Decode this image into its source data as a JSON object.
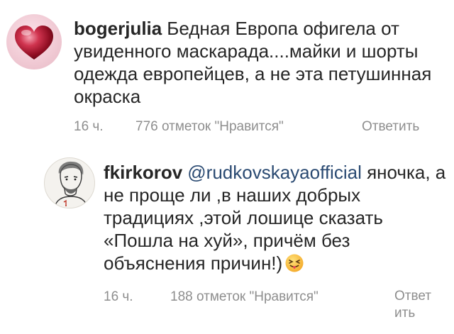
{
  "comments": [
    {
      "username": "bogerjulia",
      "text": "Бедная Европа офигела от увиденного маскарада....майки и шорты одежда европейцев, а не эта петушинная окраска",
      "time": "16 ч.",
      "likes": "776 отметок \"Нравится\"",
      "reply_label": "Ответить",
      "avatar_icon": "heart-icon"
    },
    {
      "username": "fkirkorov",
      "mention": "@rudkovskayaofficial",
      "text": "яночка, а не проще ли ,в наших добрых традициях ,этой лошице сказать «Пошла на хуй», причём без объяснения причин!)",
      "emoji_icon": "tongue-out-emoji-icon",
      "time": "16 ч.",
      "likes": "188 отметок \"Нравится\"",
      "reply_label": "Ответ ить",
      "avatar_icon": "portrait-sketch-icon"
    }
  ],
  "colors": {
    "text": "#262626",
    "meta": "#8e8e8e",
    "mention": "#2a4a72",
    "heart": "#b3122e"
  }
}
